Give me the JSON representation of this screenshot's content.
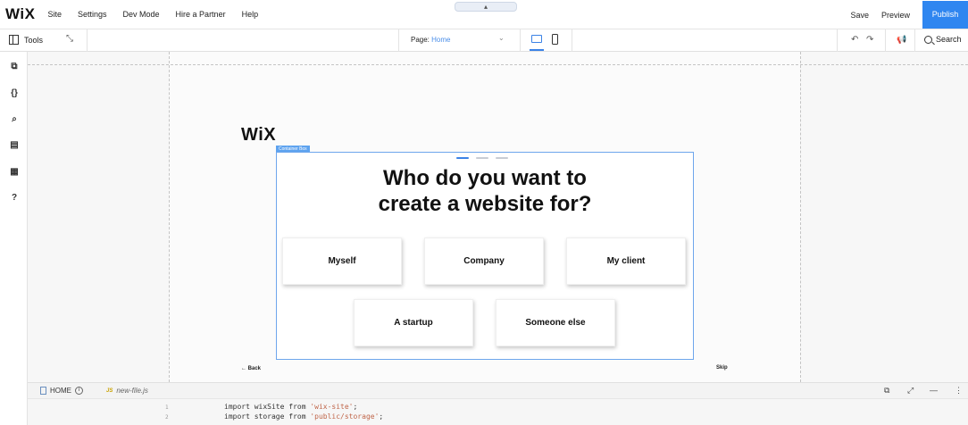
{
  "topbar": {
    "logo": "WiX",
    "menu": [
      "Site",
      "Settings",
      "Dev Mode",
      "Hire a Partner",
      "Help"
    ],
    "notch_icon": "▴",
    "save": "Save",
    "preview": "Preview",
    "publish": "Publish",
    "publish_color": "#2f86f0"
  },
  "toolbar": {
    "tools": "Tools",
    "page_label": "Page:",
    "page_value": "Home",
    "search": "Search",
    "undo_icon": "↶",
    "redo_icon": "↷",
    "collapse_icon": "⤡"
  },
  "leftrail": {
    "icons": [
      "add-elements-icon",
      "code-icon",
      "search-icon",
      "pages-icon",
      "layout-icon",
      "help-icon"
    ],
    "glyphs": [
      "⧉",
      "{}",
      "⌕",
      "▤",
      "▦",
      "?"
    ]
  },
  "canvas": {
    "logo": "WiX",
    "container_tag": "Container Box",
    "heading_line1": "Who do you want to",
    "heading_line2": "create a website for?",
    "options": [
      "Myself",
      "Company",
      "My client",
      "A startup",
      "Someone else"
    ],
    "back": "← Back",
    "skip": "Skip",
    "accent_color": "#3b82e6"
  },
  "code_panel": {
    "tab_home": "HOME",
    "tab_file": "new-file.js",
    "line1_no": "1",
    "line2_no": "2",
    "line1_a": "import wixSite from ",
    "line1_str": "'wix-site'",
    "line1_end": ";",
    "line2_a": "import storage from ",
    "line2_str": "'public/storage'",
    "line2_end": ";"
  }
}
